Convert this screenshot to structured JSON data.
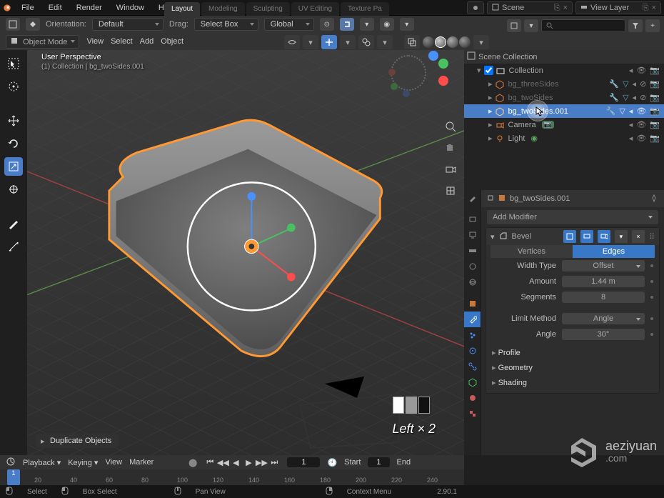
{
  "top_menu": {
    "items": [
      "File",
      "Edit",
      "Render",
      "Window",
      "Help"
    ]
  },
  "workspace_tabs": {
    "items": [
      "Layout",
      "Modeling",
      "Sculpting",
      "UV Editing",
      "Texture Pa"
    ],
    "active": 0
  },
  "scene_selectors": {
    "scene": "Scene",
    "view_layer": "View Layer"
  },
  "second_bar": {
    "orientation_label": "Orientation:",
    "orientation_value": "Default",
    "drag_label": "Drag:",
    "drag_value": "Select Box",
    "transform_orientation": "Global"
  },
  "third_bar": {
    "mode": "Object Mode",
    "menus": [
      "View",
      "Select",
      "Add",
      "Object"
    ]
  },
  "viewport_info": {
    "line1": "User Perspective",
    "line2": "(1) Collection | bg_twoSides.001"
  },
  "click_indicator": "Left × 2",
  "duplicate_label": "Duplicate Objects",
  "outliner": {
    "title": "Scene Collection",
    "rows": [
      {
        "label": "Collection",
        "icon": "collection",
        "indent": 1
      },
      {
        "label": "bg_threeSides",
        "icon": "mesh",
        "indent": 2,
        "mods": true,
        "dim": true
      },
      {
        "label": "bg_twoSides",
        "icon": "mesh",
        "indent": 2,
        "mods": true,
        "dim": true
      },
      {
        "label": "bg_twoSides.001",
        "icon": "mesh",
        "indent": 2,
        "mods": true,
        "selected": true
      },
      {
        "label": "Camera",
        "icon": "camera",
        "indent": 2,
        "cam_badge": true
      },
      {
        "label": "Light",
        "icon": "light",
        "indent": 2,
        "light_badge": true
      }
    ]
  },
  "properties": {
    "context_title": "bg_twoSides.001",
    "add_modifier": "Add Modifier",
    "modifier": {
      "name": "Bevel",
      "tabs": {
        "a": "Vertices",
        "b": "Edges",
        "active": "b"
      },
      "width_type_label": "Width Type",
      "width_type_value": "Offset",
      "amount_label": "Amount",
      "amount_value": "1.44 m",
      "segments_label": "Segments",
      "segments_value": "8",
      "limit_method_label": "Limit Method",
      "limit_method_value": "Angle",
      "angle_label": "Angle",
      "angle_value": "30°",
      "subpanels": [
        "Profile",
        "Geometry",
        "Shading"
      ]
    }
  },
  "timeline": {
    "menus": [
      "Playback",
      "Keying",
      "View",
      "Marker"
    ],
    "current_frame": "1",
    "start_label": "Start",
    "start_value": "1",
    "end_label": "End",
    "ticks": [
      "20",
      "40",
      "60",
      "80",
      "100",
      "120",
      "140",
      "160",
      "180",
      "200",
      "220",
      "240"
    ]
  },
  "statusbar": {
    "items": [
      "Select",
      "Box Select",
      "Pan View",
      "Context Menu"
    ],
    "version": "2.90.1"
  },
  "watermark": {
    "brand": "aeziyuan",
    "suffix": ".com"
  }
}
